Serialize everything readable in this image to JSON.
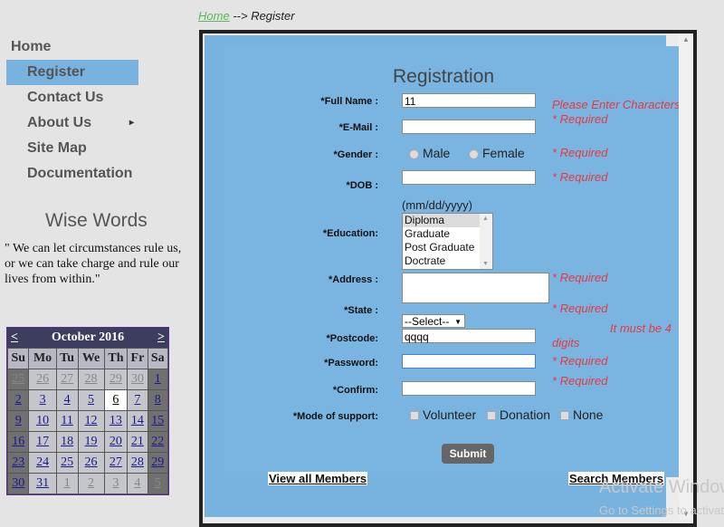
{
  "breadcrumb": {
    "home": "Home",
    "separator": "--> ",
    "current": "Register"
  },
  "nav": {
    "items": [
      {
        "label": "Home"
      },
      {
        "label": "Register"
      },
      {
        "label": "Contact Us"
      },
      {
        "label": "About Us"
      },
      {
        "label": "Site Map"
      },
      {
        "label": "Documentation"
      }
    ],
    "submenu_arrow": "▸"
  },
  "wise_words": {
    "title": "Wise Words",
    "quote": "\" We can let circumstances rule us, or we can take charge and rule our lives from within.\""
  },
  "calendar": {
    "prev": "<",
    "next": ">",
    "month": "October 2016",
    "weekdays": [
      "Su",
      "Mo",
      "Tu",
      "We",
      "Th",
      "Fr",
      "Sa"
    ],
    "weeks": [
      [
        "25",
        "26",
        "27",
        "28",
        "29",
        "30",
        "1"
      ],
      [
        "2",
        "3",
        "4",
        "5",
        "6",
        "7",
        "8"
      ],
      [
        "9",
        "10",
        "11",
        "12",
        "13",
        "14",
        "15"
      ],
      [
        "16",
        "17",
        "18",
        "19",
        "20",
        "21",
        "22"
      ],
      [
        "23",
        "24",
        "25",
        "26",
        "27",
        "28",
        "29"
      ],
      [
        "30",
        "31",
        "1",
        "2",
        "3",
        "4",
        "5"
      ]
    ],
    "today": "6"
  },
  "form": {
    "title": "Registration",
    "full_name_label": "*Full Name :",
    "full_name_value": "11",
    "full_name_error": "Please Enter Characters",
    "full_name_required": "* Required",
    "email_label": "*E-Mail :",
    "gender_label": "*Gender :",
    "gender_male": "Male",
    "gender_female": "Female",
    "gender_required": "* Required",
    "dob_label": "*DOB :",
    "dob_required": "* Required",
    "dob_hint": "(mm/dd/yyyy)",
    "education_label": "*Education:",
    "education_options": [
      "Diploma",
      "Graduate",
      "Post Graduate",
      "Doctrate"
    ],
    "address_label": "*Address :",
    "address_required": "* Required",
    "state_label": "*State :",
    "state_value": "--Select--",
    "state_required": "* Required",
    "postcode_label": "*Postcode:",
    "postcode_value": "qqqq",
    "postcode_error_line1": "It must be 4",
    "postcode_error_line2": "digits",
    "password_label": "*Password:",
    "password_required": "* Required",
    "confirm_label": "*Confirm:",
    "confirm_required": "* Required",
    "support_label": "*Mode of support:",
    "support_volunteer": "Volunteer",
    "support_donation": "Donation",
    "support_none": "None",
    "submit": "Submit",
    "view_all": "View all Members",
    "search": "Search Members"
  },
  "watermark": {
    "line1": "Activate Windows",
    "line2": "Go to Settings to activate"
  }
}
